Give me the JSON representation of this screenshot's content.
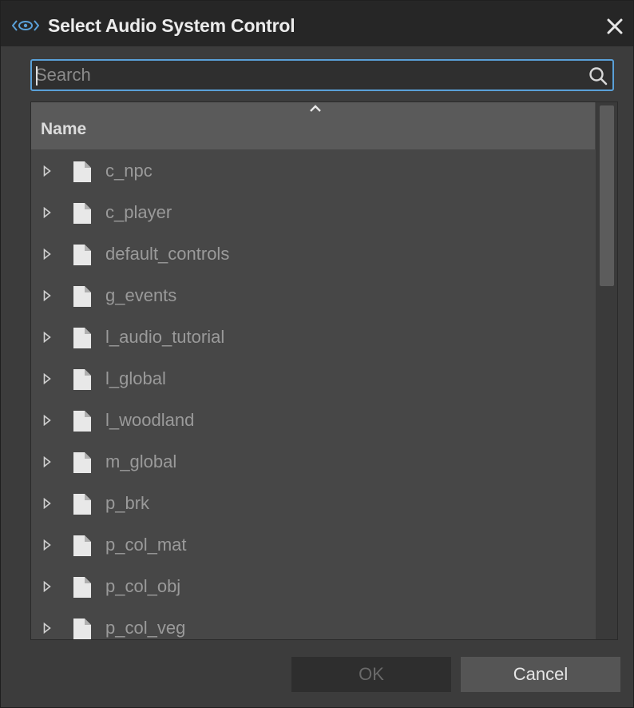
{
  "window": {
    "title": "Select Audio System Control",
    "icon": "eye-icon",
    "close_icon": "close-icon"
  },
  "search": {
    "value": "",
    "placeholder": "Search",
    "icon": "search-icon"
  },
  "tree": {
    "header": "Name",
    "sort_icon": "chevron-up-icon",
    "items": [
      {
        "label": "c_npc"
      },
      {
        "label": "c_player"
      },
      {
        "label": "default_controls"
      },
      {
        "label": "g_events"
      },
      {
        "label": "l_audio_tutorial"
      },
      {
        "label": "l_global"
      },
      {
        "label": "l_woodland"
      },
      {
        "label": "m_global"
      },
      {
        "label": "p_brk"
      },
      {
        "label": "p_col_mat"
      },
      {
        "label": "p_col_obj"
      },
      {
        "label": "p_col_veg"
      }
    ]
  },
  "buttons": {
    "ok": "OK",
    "cancel": "Cancel"
  },
  "colors": {
    "accent": "#5aa0d8",
    "background": "#3c3c3c",
    "titlebar": "#262626"
  }
}
